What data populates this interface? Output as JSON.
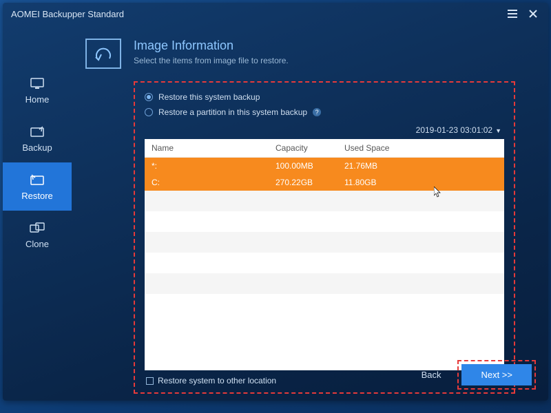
{
  "app_title": "AOMEI Backupper Standard",
  "sidebar": {
    "items": [
      {
        "label": "Home"
      },
      {
        "label": "Backup"
      },
      {
        "label": "Restore"
      },
      {
        "label": "Clone"
      }
    ]
  },
  "page": {
    "title": "Image Information",
    "subtitle": "Select the items from image file to restore."
  },
  "options": {
    "restore_system": "Restore this system backup",
    "restore_partition": "Restore a partition in this system backup"
  },
  "timestamp": "2019-01-23 03:01:02",
  "table": {
    "headers": {
      "name": "Name",
      "capacity": "Capacity",
      "used": "Used Space"
    },
    "rows": [
      {
        "name": "*:",
        "capacity": "100.00MB",
        "used": "21.76MB"
      },
      {
        "name": "C:",
        "capacity": "270.22GB",
        "used": "11.80GB"
      }
    ]
  },
  "restore_other": "Restore system to other location",
  "buttons": {
    "back": "Back",
    "next": "Next >>"
  }
}
